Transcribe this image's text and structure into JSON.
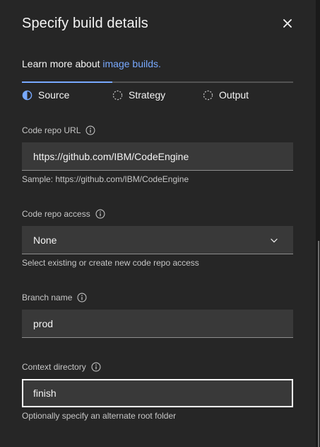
{
  "panel": {
    "title": "Specify build details",
    "learn_prefix": "Learn more about ",
    "learn_link": "image builds."
  },
  "steps": [
    {
      "label": "Source",
      "state": "current"
    },
    {
      "label": "Strategy",
      "state": "incomplete"
    },
    {
      "label": "Output",
      "state": "incomplete"
    }
  ],
  "fields": {
    "code_repo_url": {
      "label": "Code repo URL",
      "value": "https://github.com/IBM/CodeEngine",
      "helper": "Sample: https://github.com/IBM/CodeEngine"
    },
    "code_repo_access": {
      "label": "Code repo access",
      "value": "None",
      "helper": "Select existing or create new code repo access"
    },
    "branch_name": {
      "label": "Branch name",
      "value": "prod"
    },
    "context_directory": {
      "label": "Context directory",
      "value": "finish",
      "helper": "Optionally specify an alternate root folder"
    }
  },
  "colors": {
    "panel_bg": "#262626",
    "field_bg": "#393939",
    "link": "#78a9ff",
    "text": "#f4f4f4",
    "helper": "#c6c6c6"
  },
  "icons": [
    "close-icon",
    "half-circle-progress-icon",
    "dashed-circle-icon",
    "info-icon",
    "chevron-down-icon"
  ]
}
